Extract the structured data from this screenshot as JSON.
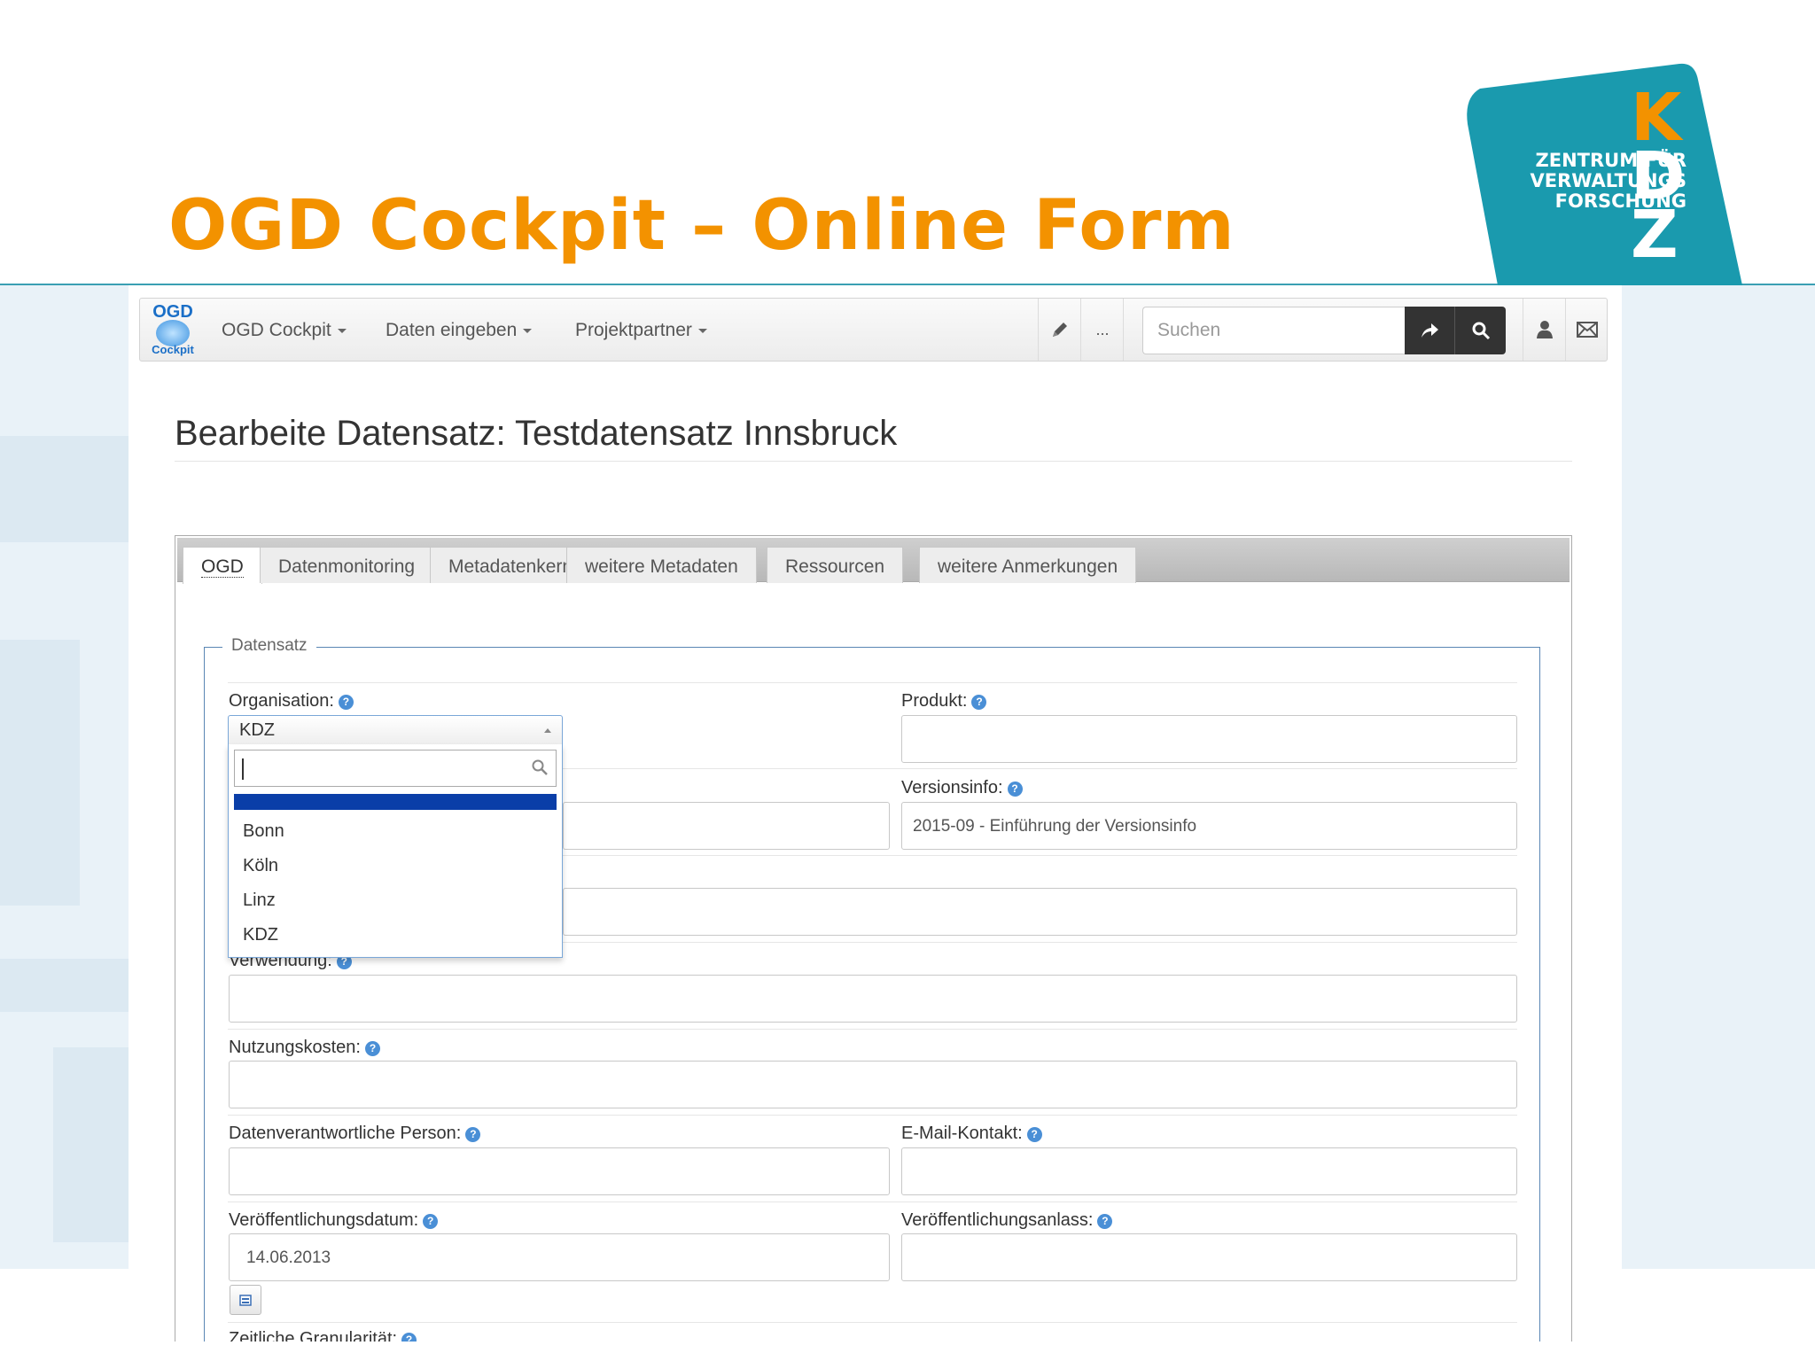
{
  "slide": {
    "title": "OGD Cockpit – Online Form",
    "logo_text": [
      "ZENTRUM FÜR",
      "VERWALTUNGS",
      "FORSCHUNG"
    ],
    "logo_letters": [
      "K",
      "D",
      "Z"
    ],
    "title_color": "#f39200",
    "logo_color": "#1a9aae"
  },
  "navbar": {
    "logo_top": "OGD",
    "logo_bottom": "Cockpit",
    "menus": [
      "OGD Cockpit",
      "Daten eingeben",
      "Projektpartner"
    ],
    "more_label": "...",
    "search_placeholder": "Suchen",
    "icons": [
      "pencil-icon",
      "share-icon",
      "search-icon",
      "user-icon",
      "mail-icon"
    ]
  },
  "page": {
    "title": "Bearbeite Datensatz: Testdatensatz Innsbruck"
  },
  "tabs": [
    "OGD",
    "Datenmonitoring",
    "Metadatenkern",
    "weitere Metadaten",
    "Ressourcen",
    "weitere Anmerkungen"
  ],
  "active_tab": "OGD",
  "form": {
    "legend": "Datensatz",
    "organisation_label": "Organisation:",
    "organisation_value": "KDZ",
    "produkt_label": "Produkt:",
    "produkt_value": "",
    "versionsinfo_label": "Versionsinfo:",
    "versionsinfo_value": "2015-09 - Einführung der Versionsinfo",
    "verwendung_label": "Verwendung:",
    "nutzungskosten_label": "Nutzungskosten:",
    "datenverantwortliche_label": "Datenverantwortliche Person:",
    "email_label": "E-Mail-Kontakt:",
    "veroeffentlichungsdatum_label": "Veröffentlichungsdatum:",
    "veroeffentlichungsdatum_value": "14.06.2013",
    "veroeffentlichungsanlass_label": "Veröffentlichungsanlass:",
    "zeitliche_label": "Zeitliche Granularität:"
  },
  "dropdown": {
    "search_value": "",
    "options": [
      "Bonn",
      "Köln",
      "Linz",
      "KDZ"
    ]
  }
}
